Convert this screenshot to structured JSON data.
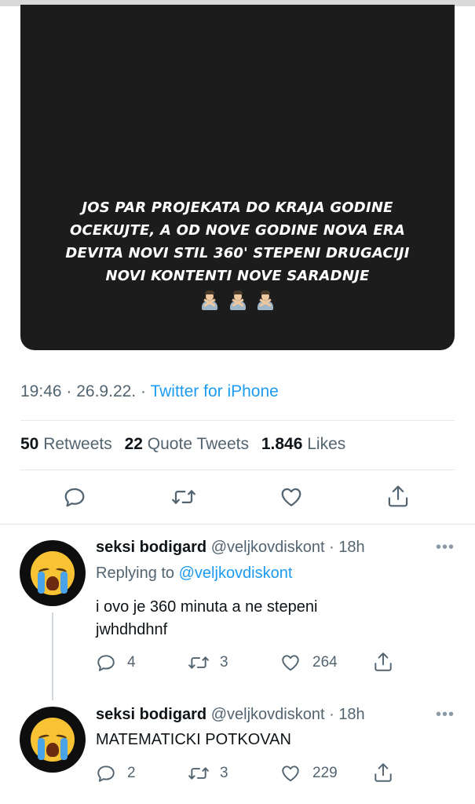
{
  "media": {
    "story_lines": [
      "JOS PAR PROJEKATA DO KRAJA GODINE",
      "OCEKUJTE,  A OD NOVE GODINE NOVA ERA",
      "DEVITA NOVI STIL 360' STEPENI DRUGACIJI",
      "NOVI KONTENTI NOVE SARADNJE"
    ]
  },
  "tweet": {
    "time": "19:46",
    "date": "26.9.22.",
    "source": "Twitter for iPhone",
    "retweets_count": "50",
    "retweets_label": "Retweets",
    "quotes_count": "22",
    "quotes_label": "Quote Tweets",
    "likes_count": "1.846",
    "likes_label": "Likes"
  },
  "replies": [
    {
      "name": "seksi bodigard",
      "handle": "@veljkovdiskont",
      "age": "18h",
      "replying_prefix": "Replying to",
      "replying_handle": "@veljkovdiskont",
      "text_line1": "i ovo je 360 minuta a ne stepeni",
      "text_line2": "jwhdhdhnf",
      "reply_count": "4",
      "retweet_count": "3",
      "like_count": "264"
    },
    {
      "name": "seksi bodigard",
      "handle": "@veljkovdiskont",
      "age": "18h",
      "text_line1": "MATEMATICKI POTKOVAN",
      "reply_count": "2",
      "retweet_count": "3",
      "like_count": "229"
    }
  ],
  "colors": {
    "accent": "#1d9bf0",
    "muted": "#536471",
    "media_bg": "#1c1c1c"
  },
  "icons": {
    "reply": "reply-icon",
    "retweet": "retweet-icon",
    "like": "heart-icon",
    "share": "share-icon",
    "more": "more-icon"
  }
}
